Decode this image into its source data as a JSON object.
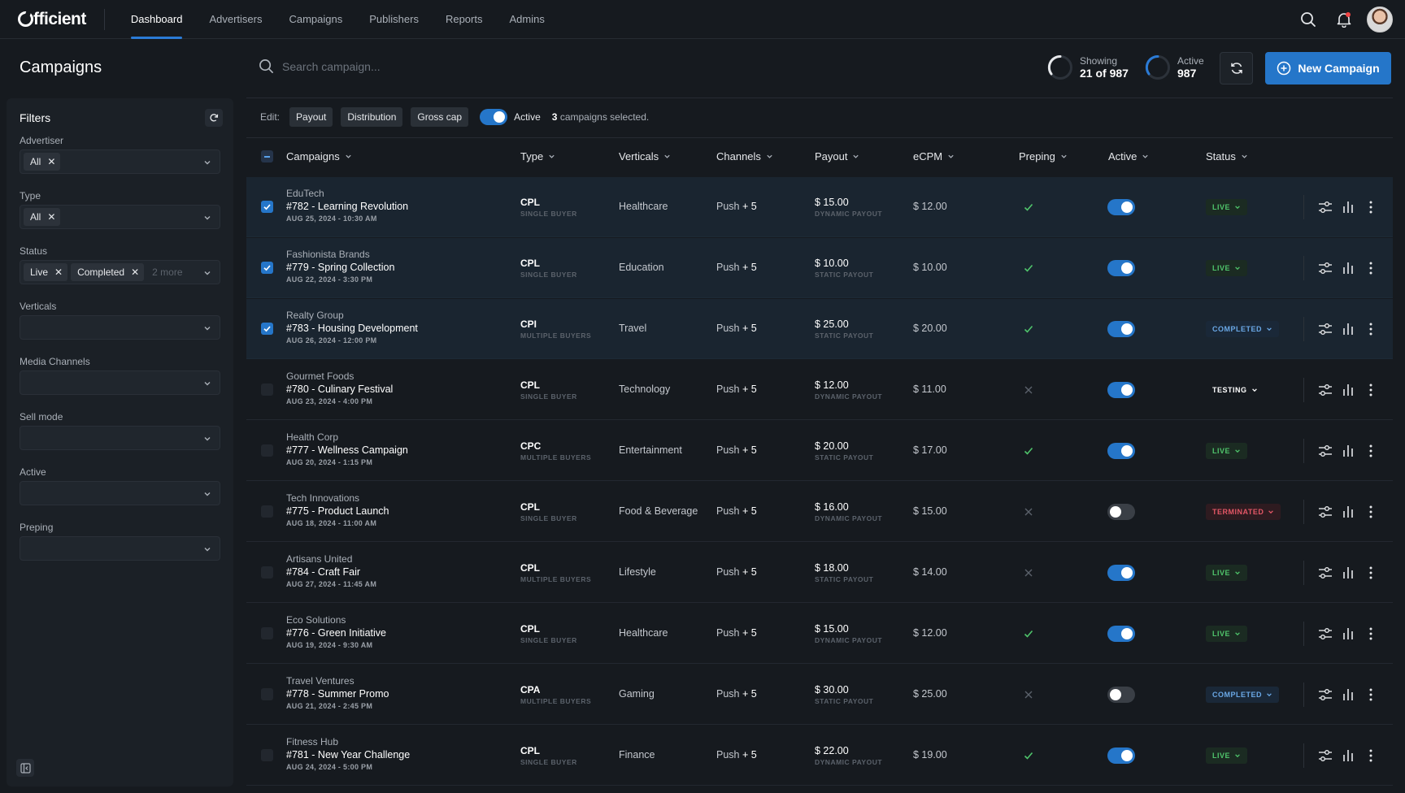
{
  "brand": {
    "logo_text": "fficient",
    "accent": "#2576c9"
  },
  "nav": {
    "links": [
      {
        "label": "Dashboard",
        "active": true
      },
      {
        "label": "Advertisers"
      },
      {
        "label": "Campaigns"
      },
      {
        "label": "Publishers"
      },
      {
        "label": "Reports"
      },
      {
        "label": "Admins"
      }
    ],
    "icons": [
      "search-icon",
      "bell-icon",
      "avatar"
    ]
  },
  "page": {
    "title": "Campaigns"
  },
  "filters": {
    "title": "Filters",
    "advertiser": {
      "label": "Advertiser",
      "chips": [
        "All"
      ]
    },
    "type": {
      "label": "Type",
      "chips": [
        "All"
      ]
    },
    "status": {
      "label": "Status",
      "chips": [
        "Live",
        "Completed"
      ],
      "more": "2 more"
    },
    "verticals": {
      "label": "Verticals"
    },
    "media_channels": {
      "label": "Media Channels"
    },
    "sell_mode": {
      "label": "Sell mode"
    },
    "active": {
      "label": "Active"
    },
    "preping": {
      "label": "Preping"
    }
  },
  "search": {
    "placeholder": "Search campaign..."
  },
  "stats": {
    "showing": {
      "label": "Showing",
      "value": "21 of 987"
    },
    "active": {
      "label": "Active",
      "value": "987"
    }
  },
  "new_campaign_label": "New Campaign",
  "editbar": {
    "label": "Edit:",
    "buttons": [
      "Payout",
      "Distribution",
      "Gross cap"
    ],
    "active_label": "Active",
    "selected_count": "3",
    "selected_suffix": "campaigns selected."
  },
  "columns": [
    "Campaigns",
    "Type",
    "Verticals",
    "Channels",
    "Payout",
    "eCPM",
    "Preping",
    "Active",
    "Status"
  ],
  "rows": [
    {
      "selected": true,
      "advertiser": "EduTech",
      "name": "#782 - Learning Revolution",
      "date": "AUG 25, 2024 - 10:30 AM",
      "type": "CPL",
      "buyer": "SINGLE BUYER",
      "vertical": "Healthcare",
      "channels": "Push",
      "channels_more": "+ 5",
      "payout": "$ 15.00",
      "payout_type": "DYNAMIC PAYOUT",
      "ecpm": "$ 12.00",
      "preping": true,
      "active": true,
      "status": "LIVE"
    },
    {
      "selected": true,
      "advertiser": "Fashionista Brands",
      "name": "#779 - Spring Collection",
      "date": "AUG 22, 2024 - 3:30 PM",
      "type": "CPL",
      "buyer": "SINGLE BUYER",
      "vertical": "Education",
      "channels": "Push",
      "channels_more": "+ 5",
      "payout": "$ 10.00",
      "payout_type": "STATIC PAYOUT",
      "ecpm": "$ 10.00",
      "preping": true,
      "active": true,
      "status": "LIVE"
    },
    {
      "selected": true,
      "advertiser": "Realty Group",
      "name": "#783 - Housing Development",
      "date": "AUG 26, 2024 - 12:00 PM",
      "type": "CPI",
      "buyer": "MULTIPLE BUYERS",
      "vertical": "Travel",
      "channels": "Push",
      "channels_more": "+ 5",
      "payout": "$ 25.00",
      "payout_type": "STATIC PAYOUT",
      "ecpm": "$ 20.00",
      "preping": true,
      "active": true,
      "status": "COMPLETED"
    },
    {
      "selected": false,
      "advertiser": "Gourmet Foods",
      "name": "#780 - Culinary Festival",
      "date": "AUG 23, 2024 - 4:00 PM",
      "type": "CPL",
      "buyer": "SINGLE BUYER",
      "vertical": "Technology",
      "channels": "Push",
      "channels_more": "+ 5",
      "payout": "$ 12.00",
      "payout_type": "DYNAMIC PAYOUT",
      "ecpm": "$ 11.00",
      "preping": false,
      "active": true,
      "status": "TESTING"
    },
    {
      "selected": false,
      "advertiser": "Health Corp",
      "name": "#777 - Wellness Campaign",
      "date": "AUG 20, 2024 - 1:15 PM",
      "type": "CPC",
      "buyer": "MULTIPLE BUYERS",
      "vertical": "Entertainment",
      "channels": "Push",
      "channels_more": "+ 5",
      "payout": "$ 20.00",
      "payout_type": "STATIC PAYOUT",
      "ecpm": "$ 17.00",
      "preping": true,
      "active": true,
      "status": "LIVE"
    },
    {
      "selected": false,
      "advertiser": "Tech Innovations",
      "name": "#775 - Product Launch",
      "date": "AUG 18, 2024 - 11:00 AM",
      "type": "CPL",
      "buyer": "SINGLE BUYER",
      "vertical": "Food & Beverage",
      "channels": "Push",
      "channels_more": "+ 5",
      "payout": "$ 16.00",
      "payout_type": "DYNAMIC PAYOUT",
      "ecpm": "$ 15.00",
      "preping": false,
      "active": false,
      "status": "TERMINATED"
    },
    {
      "selected": false,
      "advertiser": "Artisans United",
      "name": "#784 - Craft Fair",
      "date": "AUG 27, 2024 - 11:45 AM",
      "type": "CPL",
      "buyer": "MULTIPLE BUYERS",
      "vertical": "Lifestyle",
      "channels": "Push",
      "channels_more": "+ 5",
      "payout": "$ 18.00",
      "payout_type": "STATIC PAYOUT",
      "ecpm": "$ 14.00",
      "preping": false,
      "active": true,
      "status": "LIVE"
    },
    {
      "selected": false,
      "advertiser": "Eco Solutions",
      "name": "#776 - Green Initiative",
      "date": "AUG 19, 2024 - 9:30 AM",
      "type": "CPL",
      "buyer": "SINGLE BUYER",
      "vertical": "Healthcare",
      "channels": "Push",
      "channels_more": "+ 5",
      "payout": "$ 15.00",
      "payout_type": "DYNAMIC PAYOUT",
      "ecpm": "$ 12.00",
      "preping": true,
      "active": true,
      "status": "LIVE"
    },
    {
      "selected": false,
      "advertiser": "Travel Ventures",
      "name": "#778 - Summer Promo",
      "date": "AUG 21, 2024 - 2:45 PM",
      "type": "CPA",
      "buyer": "MULTIPLE BUYERS",
      "vertical": "Gaming",
      "channels": "Push",
      "channels_more": "+ 5",
      "payout": "$ 30.00",
      "payout_type": "STATIC PAYOUT",
      "ecpm": "$ 25.00",
      "preping": false,
      "active": false,
      "status": "COMPLETED"
    },
    {
      "selected": false,
      "advertiser": "Fitness Hub",
      "name": "#781 - New Year Challenge",
      "date": "AUG 24, 2024 - 5:00 PM",
      "type": "CPL",
      "buyer": "SINGLE BUYER",
      "vertical": "Finance",
      "channels": "Push",
      "channels_more": "+ 5",
      "payout": "$ 22.00",
      "payout_type": "DYNAMIC PAYOUT",
      "ecpm": "$ 19.00",
      "preping": true,
      "active": true,
      "status": "LIVE"
    }
  ]
}
